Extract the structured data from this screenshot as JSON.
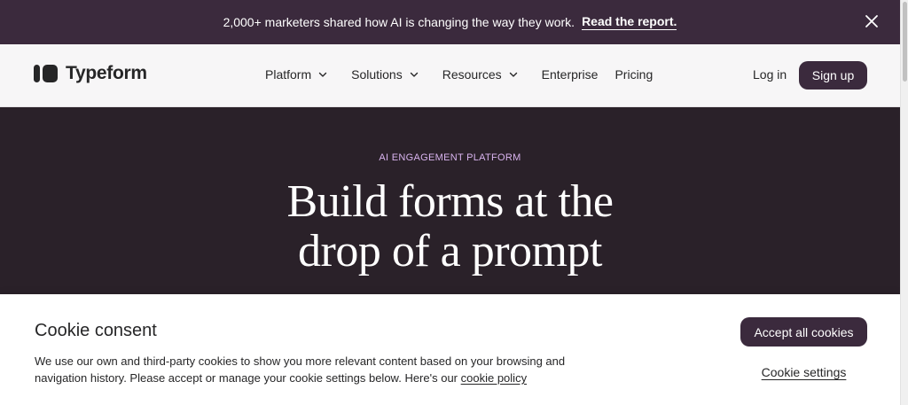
{
  "announcement": {
    "message": "2,000+ marketers shared how AI is changing the way they work.",
    "link_label": "Read the report."
  },
  "nav": {
    "brand": "Typeform",
    "items": [
      {
        "label": "Platform",
        "has_dropdown": true
      },
      {
        "label": "Solutions",
        "has_dropdown": true
      },
      {
        "label": "Resources",
        "has_dropdown": true
      },
      {
        "label": "Enterprise",
        "has_dropdown": false
      },
      {
        "label": "Pricing",
        "has_dropdown": false
      }
    ],
    "login_label": "Log in",
    "signup_label": "Sign up"
  },
  "hero": {
    "eyebrow": "AI ENGAGEMENT PLATFORM",
    "headline_line1": "Build forms at the",
    "headline_line2": "drop of a prompt"
  },
  "cookie": {
    "title": "Cookie consent",
    "body": "We use our own and third-party cookies to show you more relevant content based on your browsing and navigation history. Please accept or manage your cookie settings below. Here's our",
    "policy_link": "cookie policy",
    "accept_label": "Accept all cookies",
    "settings_label": "Cookie settings"
  },
  "colors": {
    "announcement_bg": "#3b2a3d",
    "hero_bg": "#2a2129",
    "accent_eyebrow": "#d9b4ef",
    "button_bg": "#3b2a3d"
  },
  "icons": [
    "close-icon",
    "chevron-down-icon",
    "typeform-logo-icon"
  ]
}
